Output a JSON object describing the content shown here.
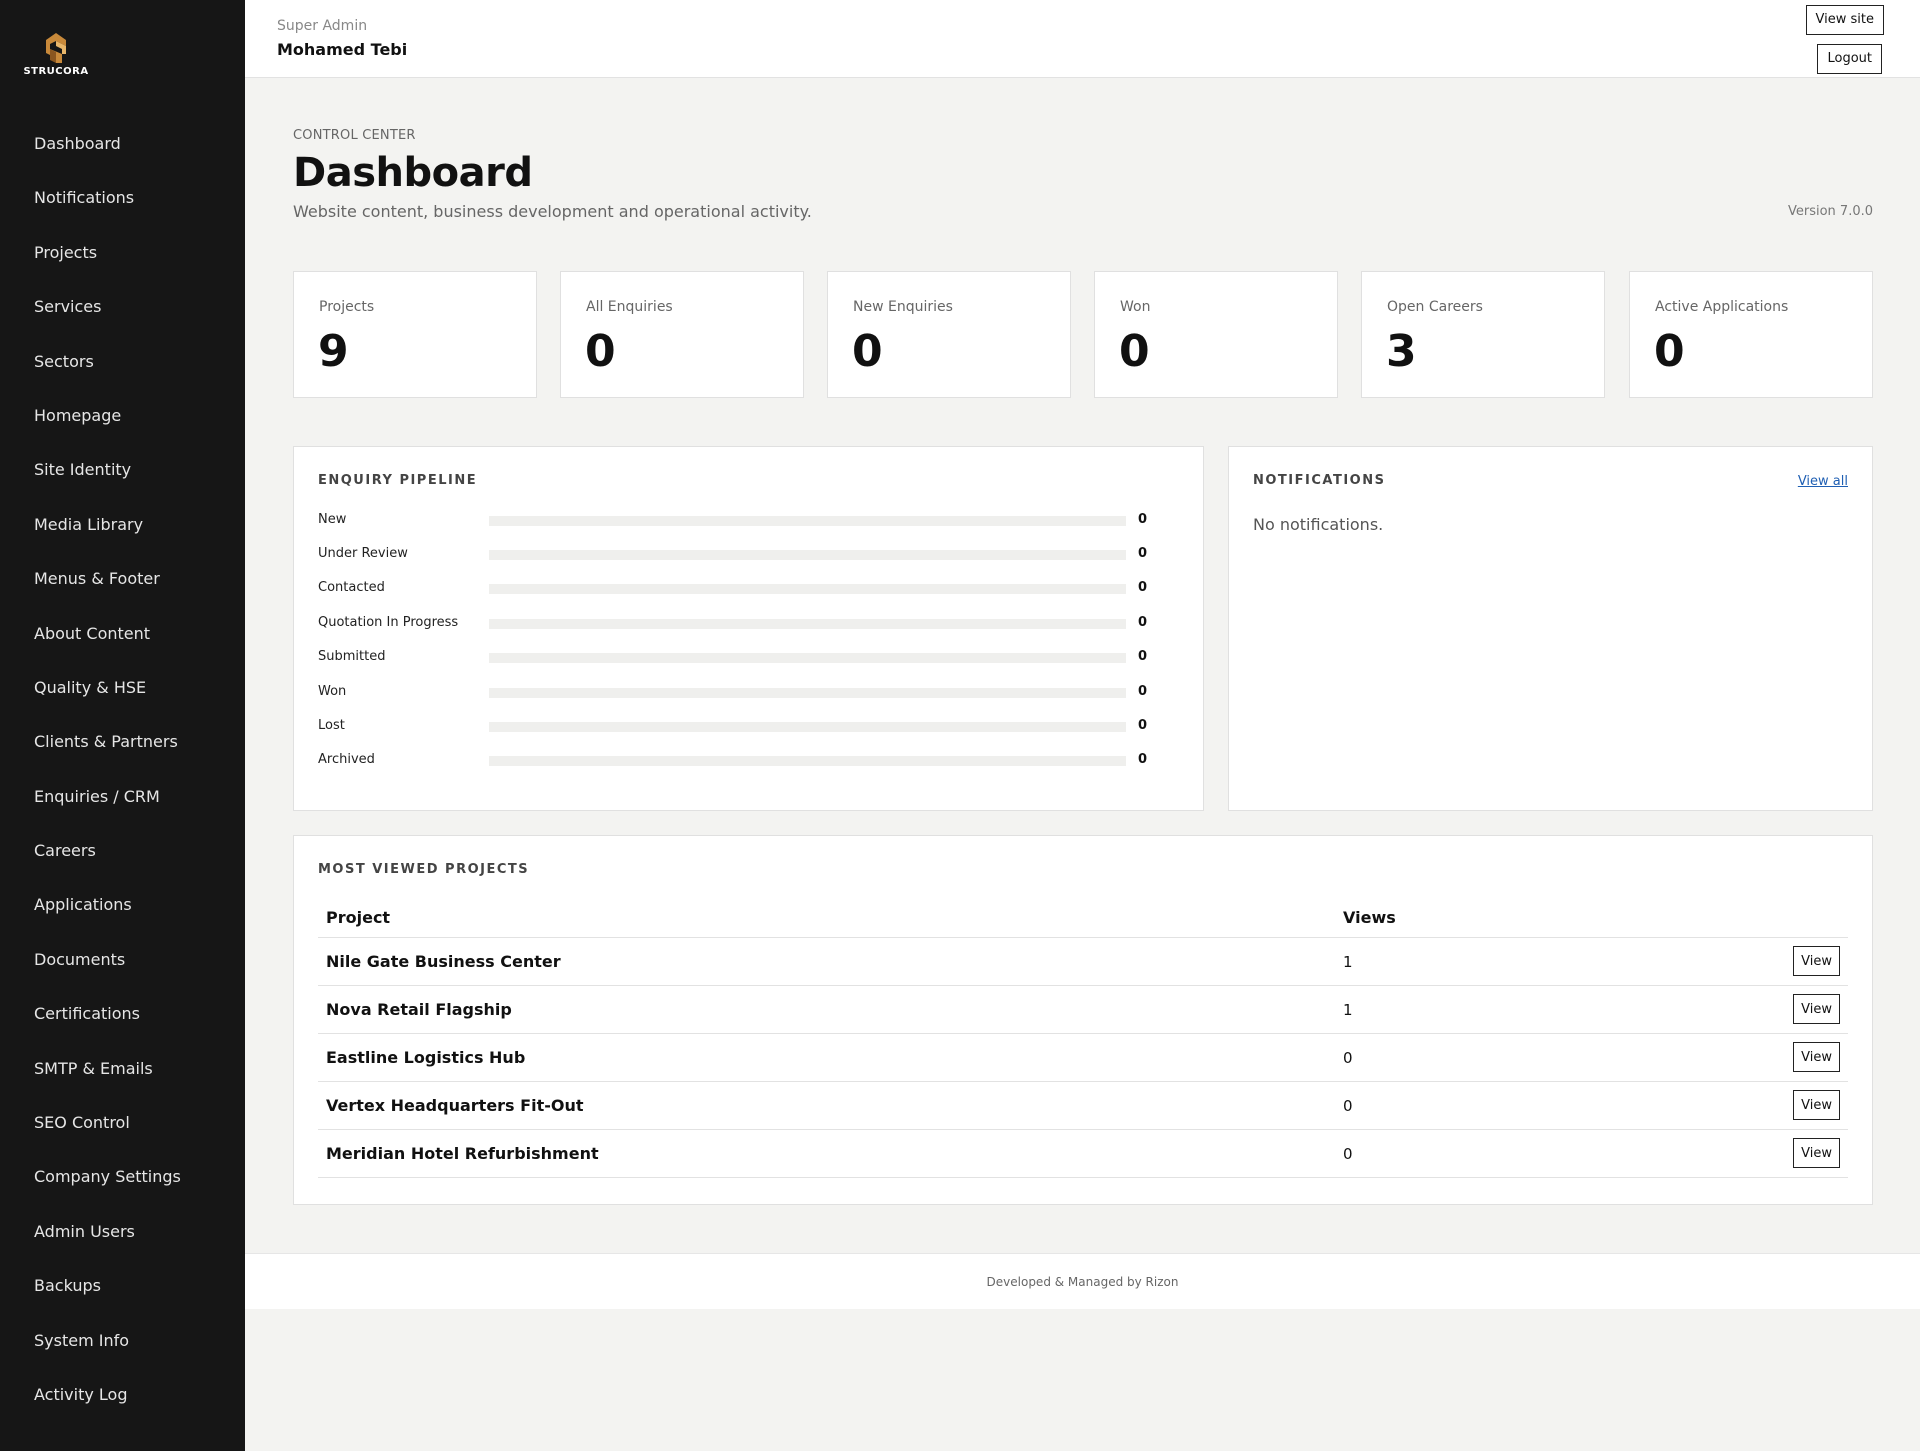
{
  "brand": {
    "logo_text": "STRUCORA",
    "logo_color": "#c8893a"
  },
  "sidebar": {
    "items": [
      {
        "label": "Dashboard"
      },
      {
        "label": "Notifications"
      },
      {
        "label": "Projects"
      },
      {
        "label": "Services"
      },
      {
        "label": "Sectors"
      },
      {
        "label": "Homepage"
      },
      {
        "label": "Site Identity"
      },
      {
        "label": "Media Library"
      },
      {
        "label": "Menus & Footer"
      },
      {
        "label": "About Content"
      },
      {
        "label": "Quality & HSE"
      },
      {
        "label": "Clients & Partners"
      },
      {
        "label": "Enquiries / CRM"
      },
      {
        "label": "Careers"
      },
      {
        "label": "Applications"
      },
      {
        "label": "Documents"
      },
      {
        "label": "Certifications"
      },
      {
        "label": "SMTP & Emails"
      },
      {
        "label": "SEO Control"
      },
      {
        "label": "Company Settings"
      },
      {
        "label": "Admin Users"
      },
      {
        "label": "Backups"
      },
      {
        "label": "System Info"
      },
      {
        "label": "Activity Log"
      }
    ]
  },
  "header": {
    "role": "Super Admin",
    "user_name": "Mohamed Tebi",
    "view_site_label": "View site",
    "logout_label": "Logout"
  },
  "page": {
    "eyebrow": "CONTROL CENTER",
    "title": "Dashboard",
    "subtitle": "Website content, business development and operational activity.",
    "version": "Version 7.0.0"
  },
  "stats": [
    {
      "label": "Projects",
      "value": "9"
    },
    {
      "label": "All Enquiries",
      "value": "0"
    },
    {
      "label": "New Enquiries",
      "value": "0"
    },
    {
      "label": "Won",
      "value": "0"
    },
    {
      "label": "Open Careers",
      "value": "3"
    },
    {
      "label": "Active Applications",
      "value": "0"
    }
  ],
  "pipeline": {
    "title": "ENQUIRY PIPELINE",
    "stages": [
      {
        "label": "New",
        "count": "0",
        "fill": 0
      },
      {
        "label": "Under Review",
        "count": "0",
        "fill": 0
      },
      {
        "label": "Contacted",
        "count": "0",
        "fill": 0
      },
      {
        "label": "Quotation In Progress",
        "count": "0",
        "fill": 0
      },
      {
        "label": "Submitted",
        "count": "0",
        "fill": 0
      },
      {
        "label": "Won",
        "count": "0",
        "fill": 0
      },
      {
        "label": "Lost",
        "count": "0",
        "fill": 0
      },
      {
        "label": "Archived",
        "count": "0",
        "fill": 0
      }
    ]
  },
  "notifications": {
    "title": "NOTIFICATIONS",
    "view_all_label": "View all",
    "empty_text": "No notifications."
  },
  "most_viewed": {
    "title": "MOST VIEWED PROJECTS",
    "columns": {
      "project": "Project",
      "views": "Views"
    },
    "rows": [
      {
        "name": "Nile Gate Business Center",
        "views": "1",
        "action": "View"
      },
      {
        "name": "Nova Retail Flagship",
        "views": "1",
        "action": "View"
      },
      {
        "name": "Eastline Logistics Hub",
        "views": "0",
        "action": "View"
      },
      {
        "name": "Vertex Headquarters Fit-Out",
        "views": "0",
        "action": "View"
      },
      {
        "name": "Meridian Hotel Refurbishment",
        "views": "0",
        "action": "View"
      }
    ]
  },
  "footer": {
    "text": "Developed & Managed by Rizon"
  }
}
